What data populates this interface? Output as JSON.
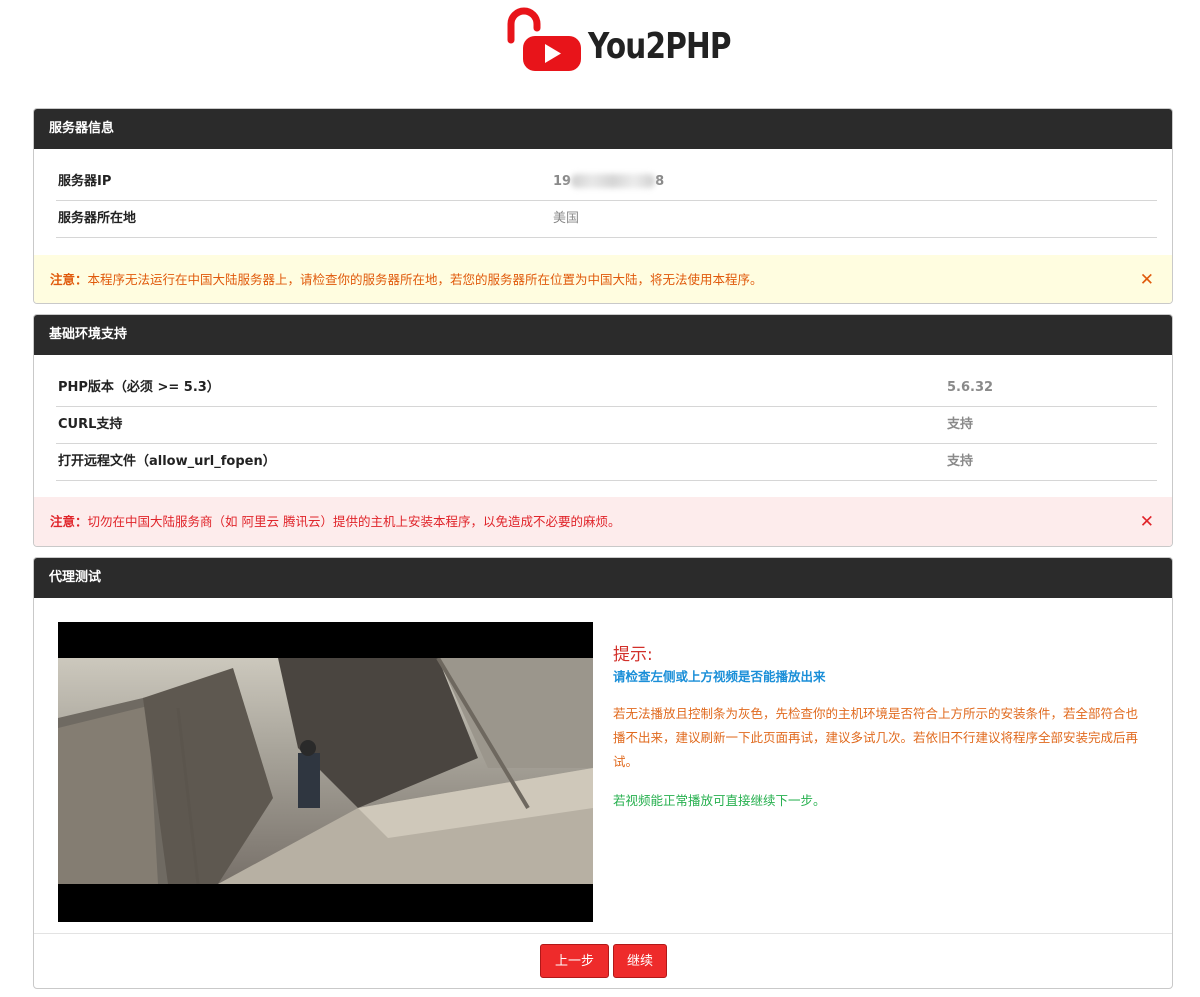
{
  "logo": {
    "text": "You2PHP"
  },
  "server_panel": {
    "title": "服务器信息",
    "rows": [
      {
        "key": "服务器IP",
        "value_prefix": "19",
        "value_suffix": "8"
      },
      {
        "key": "服务器所在地",
        "value": "美国"
      }
    ],
    "alert": {
      "label": "注意：",
      "text": "本程序无法运行在中国大陆服务器上，请检查你的服务器所在地，若您的服务器所在位置为中国大陆，将无法使用本程序。",
      "close": "✕"
    }
  },
  "env_panel": {
    "title": "基础环境支持",
    "rows": [
      {
        "key": "PHP版本（必须 >= 5.3）",
        "value": "5.6.32"
      },
      {
        "key": "CURL支持",
        "value": "支持"
      },
      {
        "key": "打开远程文件（allow_url_fopen）",
        "value": "支持"
      }
    ],
    "alert": {
      "label": "注意：",
      "text": "切勿在中国大陆服务商（如 阿里云 腾讯云）提供的主机上安装本程序，以免造成不必要的麻烦。",
      "close": "✕"
    }
  },
  "proxy_panel": {
    "title": "代理测试",
    "tip": {
      "title": "提示:",
      "subtitle": "请检查左侧或上方视频是否能播放出来",
      "body": "若无法播放且控制条为灰色，先检查你的主机环境是否符合上方所示的安装条件，若全部符合也播不出来，建议刷新一下此页面再试，建议多试几次。若依旧不行建议将程序全部安装完成后再试。",
      "ok": "若视频能正常播放可直接继续下一步。"
    },
    "buttons": {
      "prev": "上一步",
      "next": "继续"
    }
  },
  "colors": {
    "header_bg": "#2b2b2b",
    "warn_text": "#e05a0c",
    "danger_text": "#e0242a",
    "button_bg": "#ee2b2b",
    "logo_red": "#e8141a"
  }
}
